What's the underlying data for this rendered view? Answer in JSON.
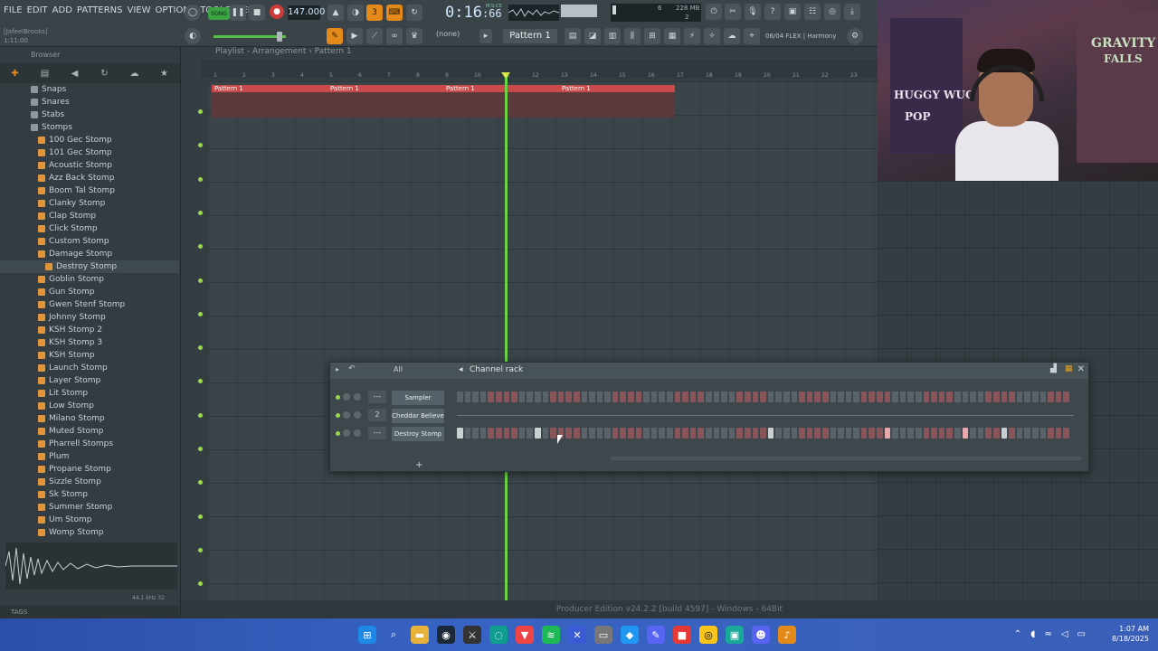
{
  "menu": [
    "FILE",
    "EDIT",
    "ADD",
    "PATTERNS",
    "VIEW",
    "OPTIONS",
    "TOOLS",
    "HELP"
  ],
  "hint": {
    "user": "[JafeelBrooks]",
    "pos": "1:11:00"
  },
  "toolbar": {
    "song_label": "SONG",
    "tempo": "147.000",
    "time": "0:16",
    "time_sub": ":66",
    "time_unit": "M:S:CS",
    "cpu_mem": "228 MB",
    "cpu_a": "6",
    "cpu_b": "2",
    "snap": "(none)",
    "pattern": "Pattern 1",
    "flex_hint": "06/04  FLEX | Harmony"
  },
  "browser": {
    "title": "Browser",
    "items": [
      {
        "label": "Snaps",
        "type": "folder"
      },
      {
        "label": "Snares",
        "type": "folder"
      },
      {
        "label": "Stabs",
        "type": "folder"
      },
      {
        "label": "Stomps",
        "type": "folder-open"
      },
      {
        "label": "100 Gec Stomp",
        "type": "file"
      },
      {
        "label": "101 Gec Stomp",
        "type": "file"
      },
      {
        "label": "Acoustic Stomp",
        "type": "file"
      },
      {
        "label": "Azz Back Stomp",
        "type": "file"
      },
      {
        "label": "Boom Tal Stomp",
        "type": "file"
      },
      {
        "label": "Clanky Stomp",
        "type": "file"
      },
      {
        "label": "Clap Stomp",
        "type": "file"
      },
      {
        "label": "Click Stomp",
        "type": "file"
      },
      {
        "label": "Custom Stomp",
        "type": "file"
      },
      {
        "label": "Damage Stomp",
        "type": "file"
      },
      {
        "label": "Destroy Stomp",
        "type": "file-selected"
      },
      {
        "label": "Goblin Stomp",
        "type": "file"
      },
      {
        "label": "Gun Stomp",
        "type": "file"
      },
      {
        "label": "Gwen Stenf Stomp",
        "type": "file"
      },
      {
        "label": "Johnny Stomp",
        "type": "file"
      },
      {
        "label": "KSH Stomp 2",
        "type": "file"
      },
      {
        "label": "KSH Stomp 3",
        "type": "file"
      },
      {
        "label": "KSH Stomp",
        "type": "file"
      },
      {
        "label": "Launch Stomp",
        "type": "file"
      },
      {
        "label": "Layer Stomp",
        "type": "file"
      },
      {
        "label": "Lit Stomp",
        "type": "file"
      },
      {
        "label": "Low Stomp",
        "type": "file"
      },
      {
        "label": "Milano Stomp",
        "type": "file"
      },
      {
        "label": "Muted Stomp",
        "type": "file"
      },
      {
        "label": "Pharrell Stomps",
        "type": "file"
      },
      {
        "label": "Plum",
        "type": "file"
      },
      {
        "label": "Propane Stomp",
        "type": "file"
      },
      {
        "label": "Sizzle Stomp",
        "type": "file"
      },
      {
        "label": "Sk Stomp",
        "type": "file"
      },
      {
        "label": "Summer Stomp",
        "type": "file"
      },
      {
        "label": "Um Stomp",
        "type": "file"
      },
      {
        "label": "Womp Stomp",
        "type": "file"
      }
    ],
    "sample_info": "44.1 kHz 32",
    "tags": "TAGS"
  },
  "playlist": {
    "title": "Playlist - Arrangement › Pattern 1",
    "ruler": [
      "1",
      "2",
      "3",
      "4",
      "5",
      "6",
      "7",
      "8",
      "9",
      "10",
      "11",
      "12",
      "13",
      "14",
      "15",
      "16",
      "17",
      "18",
      "19",
      "20",
      "21",
      "22",
      "23"
    ],
    "clips": [
      "Pattern 1",
      "Pattern 1",
      "Pattern 1",
      "Pattern 1"
    ]
  },
  "channel_rack": {
    "filter": "All",
    "title": "Channel rack",
    "channels": [
      {
        "num": "---",
        "name": "Sampler"
      },
      {
        "num": "2",
        "name": "Cheddar Believe"
      },
      {
        "num": "---",
        "name": "Destroy Stomp"
      }
    ]
  },
  "webcam": {
    "text_a": "GRAVITY",
    "text_b": "FALLS",
    "text_c": "HUGGY WUG",
    "text_d": "POP"
  },
  "status": "Producer Edition v24.2.2 [build 4597] - Windows - 64Bit",
  "taskbar": {
    "time": "1:07 AM",
    "date": "8/18/2025"
  }
}
